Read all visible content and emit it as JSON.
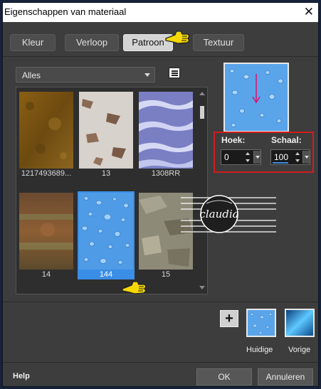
{
  "window": {
    "title": "Eigenschappen van materiaal",
    "close_glyph": "✕"
  },
  "tabs": [
    {
      "label": "Kleur",
      "active": false
    },
    {
      "label": "Verloop",
      "active": false
    },
    {
      "label": "Patroon",
      "active": true
    },
    {
      "label": "Textuur",
      "active": false
    }
  ],
  "category": {
    "selected": "Alles"
  },
  "gallery": {
    "items": [
      {
        "label": "1217493689...",
        "selected": false
      },
      {
        "label": "13",
        "selected": false
      },
      {
        "label": "1308RR",
        "selected": false
      },
      {
        "label": "14",
        "selected": false
      },
      {
        "label": "144",
        "selected": true
      },
      {
        "label": "15",
        "selected": false
      }
    ]
  },
  "settings": {
    "angle_label": "Hoek:",
    "angle_value": "0",
    "scale_label": "Schaal:",
    "scale_value": "100"
  },
  "swatches": {
    "current_label": "Huidige",
    "previous_label": "Vorige",
    "add_glyph": "+"
  },
  "footer": {
    "help": "Help",
    "ok": "OK",
    "cancel": "Annuleren"
  },
  "watermark": {
    "text": "claudia"
  },
  "colors": {
    "dialog_bg": "#3d3d3d",
    "selection": "#3a8ee6",
    "highlight_border": "#d21c1c",
    "pointer": "#f5d800"
  },
  "icons": [
    "close-icon",
    "dropdown-arrow-icon",
    "document-icon",
    "pointing-hand-icon",
    "plus-icon",
    "spin-up-down-icon"
  ]
}
